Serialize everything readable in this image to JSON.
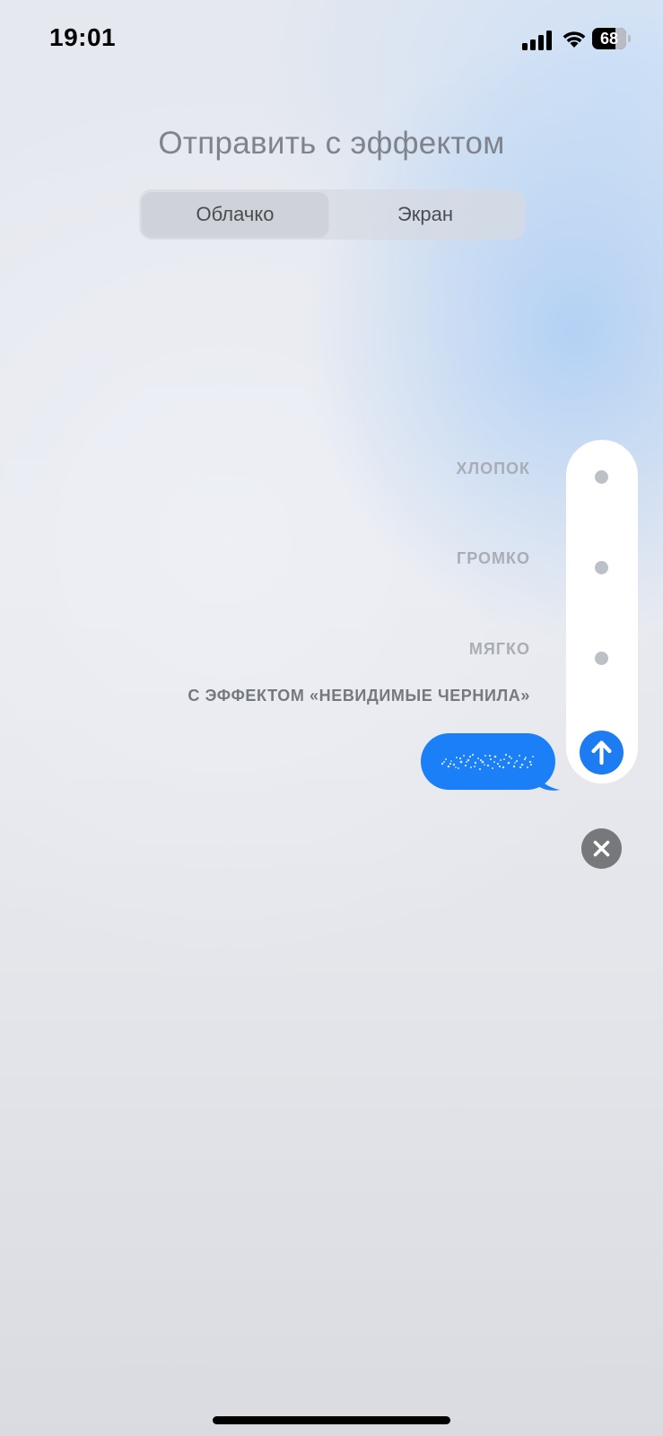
{
  "status_bar": {
    "time": "19:01",
    "battery_level": "68",
    "battery_percent": 68,
    "signal_bars": 4,
    "icons": [
      "signal-icon",
      "wifi-icon",
      "battery-icon"
    ]
  },
  "header": {
    "title": "Отправить с эффектом"
  },
  "segmented_control": {
    "selected": "bubble",
    "segments": [
      {
        "id": "bubble",
        "label": "Облачко"
      },
      {
        "id": "screen",
        "label": "Экран"
      }
    ]
  },
  "effects": {
    "options": [
      {
        "label": "ХЛОПОК",
        "selected": false
      },
      {
        "label": "ГРОМКО",
        "selected": false
      },
      {
        "label": "МЯГКО",
        "selected": false
      },
      {
        "label": "С ЭФФЕКТОМ «НЕВИДИМЫЕ ЧЕРНИЛА»",
        "selected": true
      }
    ]
  },
  "message": {
    "effect": "invisible-ink"
  },
  "controls": {
    "send_icon": "arrow-up-icon",
    "close_icon": "close-icon"
  },
  "colors": {
    "accent": "#1d7cf2",
    "bubble": "#1b80f7",
    "close_button": "#76787c",
    "title_text": "#7f848c"
  }
}
